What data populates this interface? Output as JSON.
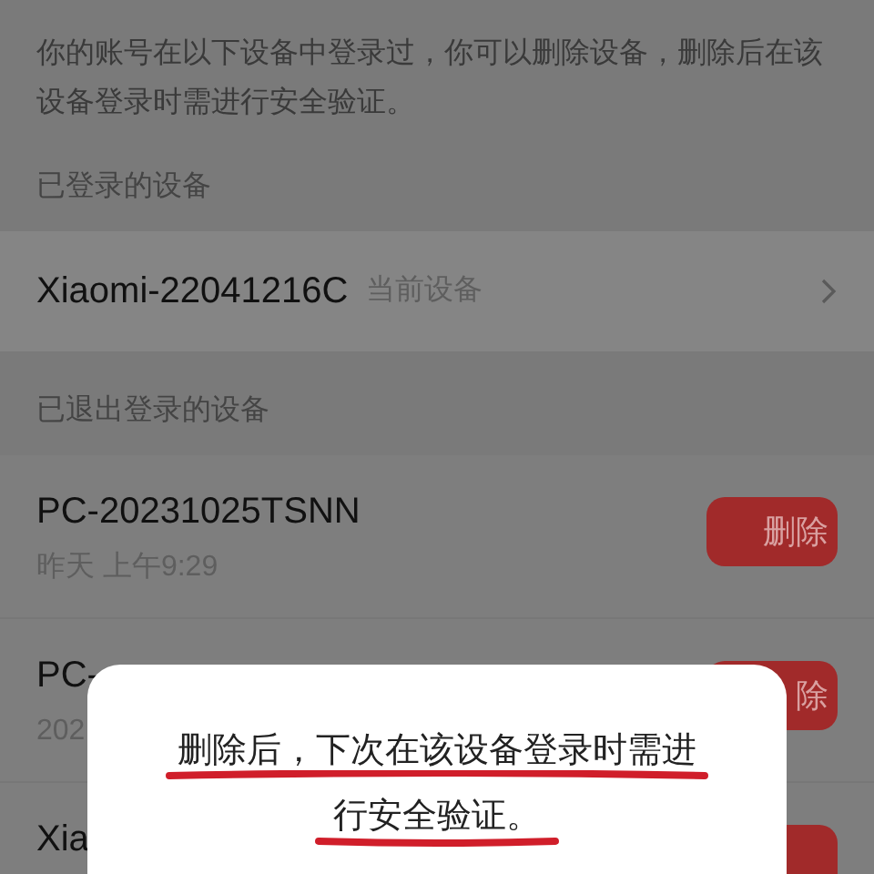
{
  "intro": "你的账号在以下设备中登录过，你可以删除设备，删除后在该设备登录时需进行安全验证。",
  "sections": [
    {
      "title": "已登录的设备",
      "devices": [
        {
          "kind": "current",
          "name": "Xiaomi-22041216C",
          "tag": "当前设备"
        }
      ]
    },
    {
      "title": "已退出登录的设备",
      "devices": [
        {
          "kind": "removable",
          "name": "PC-20231025TSNN",
          "time": "昨天 上午9:29",
          "action": "删除"
        },
        {
          "kind": "removable",
          "name": "PC-",
          "time": "202",
          "action": "除"
        },
        {
          "kind": "removable",
          "name": "Xia"
        }
      ]
    }
  ],
  "dialog": {
    "message_lines": [
      "删除后，下次在该设备登录时需进",
      "行安全验证。"
    ]
  }
}
